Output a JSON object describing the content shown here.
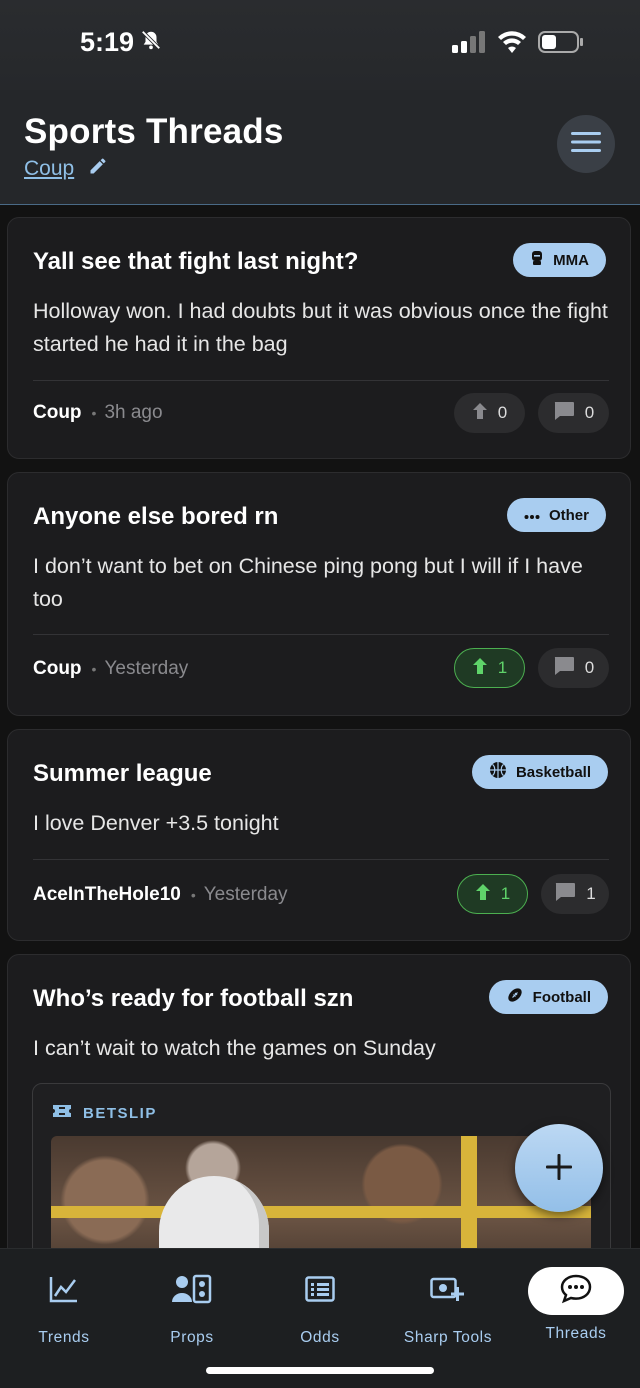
{
  "status_bar": {
    "time": "5:19"
  },
  "header": {
    "title": "Sports Threads",
    "username": "Coup"
  },
  "threads": [
    {
      "title": "Yall see that fight last night?",
      "tag": "MMA",
      "tag_icon": "boxing-glove-icon",
      "body": "Holloway won. I had doubts but it was obvious once the fight started he had it in the bag",
      "author": "Coup",
      "time_ago": "3h ago",
      "upvotes": "0",
      "upvoted": false,
      "comments": "0"
    },
    {
      "title": "Anyone else bored rn",
      "tag": "Other",
      "tag_icon": "ellipsis-icon",
      "body": "I don’t want to bet on Chinese ping pong but I will if I have too",
      "author": "Coup",
      "time_ago": "Yesterday",
      "upvotes": "1",
      "upvoted": true,
      "comments": "0"
    },
    {
      "title": "Summer league",
      "tag": "Basketball",
      "tag_icon": "basketball-icon",
      "body": "I love Denver +3.5 tonight",
      "author": "AceInTheHole10",
      "time_ago": "Yesterday",
      "upvotes": "1",
      "upvoted": true,
      "comments": "1"
    },
    {
      "title": "Who’s ready for football szn",
      "tag": "Football",
      "tag_icon": "football-icon",
      "body": "I can’t wait to watch the games on Sunday",
      "betslip_label": "BETSLIP"
    }
  ],
  "nav": {
    "tabs": [
      {
        "label": "Trends",
        "icon": "chart-line-icon"
      },
      {
        "label": "Props",
        "icon": "props-icon"
      },
      {
        "label": "Odds",
        "icon": "list-icon"
      },
      {
        "label": "Sharp Tools",
        "icon": "sharp-tools-icon"
      },
      {
        "label": "Threads",
        "icon": "chat-bubble-icon",
        "active": true
      }
    ]
  },
  "colors": {
    "accent": "#a9cdf0",
    "upvote_active": "#4caf50",
    "background": "#121212",
    "card": "#1c1c1e"
  }
}
